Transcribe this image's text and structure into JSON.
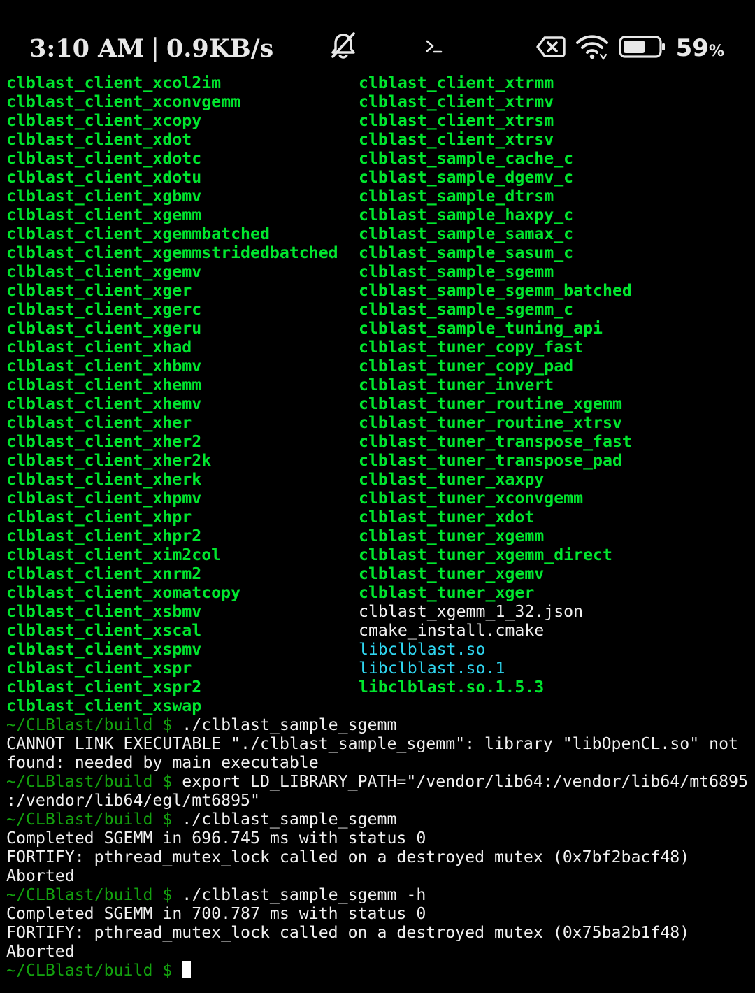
{
  "status_bar": {
    "time": "3:10 AM",
    "separator": "|",
    "net_speed": "0.9KB/s",
    "battery_percent": "59",
    "battery_percent_sign": "%",
    "battery_level": 0.59,
    "icons": [
      "bell-muted-icon",
      "terminal-prompt-icon",
      "sim-error-icon",
      "wifi-icon",
      "battery-icon"
    ]
  },
  "ls_listing": {
    "left_column": [
      "clblast_client_xcol2im",
      "clblast_client_xconvgemm",
      "clblast_client_xcopy",
      "clblast_client_xdot",
      "clblast_client_xdotc",
      "clblast_client_xdotu",
      "clblast_client_xgbmv",
      "clblast_client_xgemm",
      "clblast_client_xgemmbatched",
      "clblast_client_xgemmstridedbatched",
      "clblast_client_xgemv",
      "clblast_client_xger",
      "clblast_client_xgerc",
      "clblast_client_xgeru",
      "clblast_client_xhad",
      "clblast_client_xhbmv",
      "clblast_client_xhemm",
      "clblast_client_xhemv",
      "clblast_client_xher",
      "clblast_client_xher2",
      "clblast_client_xher2k",
      "clblast_client_xherk",
      "clblast_client_xhpmv",
      "clblast_client_xhpr",
      "clblast_client_xhpr2",
      "clblast_client_xim2col",
      "clblast_client_xnrm2",
      "clblast_client_xomatcopy",
      "clblast_client_xsbmv",
      "clblast_client_xscal",
      "clblast_client_xspmv",
      "clblast_client_xspr",
      "clblast_client_xspr2",
      "clblast_client_xswap"
    ],
    "right_column": [
      {
        "name": "clblast_client_xtrmm",
        "kind": "exec"
      },
      {
        "name": "clblast_client_xtrmv",
        "kind": "exec"
      },
      {
        "name": "clblast_client_xtrsm",
        "kind": "exec"
      },
      {
        "name": "clblast_client_xtrsv",
        "kind": "exec"
      },
      {
        "name": "clblast_sample_cache_c",
        "kind": "exec"
      },
      {
        "name": "clblast_sample_dgemv_c",
        "kind": "exec"
      },
      {
        "name": "clblast_sample_dtrsm",
        "kind": "exec"
      },
      {
        "name": "clblast_sample_haxpy_c",
        "kind": "exec"
      },
      {
        "name": "clblast_sample_samax_c",
        "kind": "exec"
      },
      {
        "name": "clblast_sample_sasum_c",
        "kind": "exec"
      },
      {
        "name": "clblast_sample_sgemm",
        "kind": "exec"
      },
      {
        "name": "clblast_sample_sgemm_batched",
        "kind": "exec"
      },
      {
        "name": "clblast_sample_sgemm_c",
        "kind": "exec"
      },
      {
        "name": "clblast_sample_tuning_api",
        "kind": "exec"
      },
      {
        "name": "clblast_tuner_copy_fast",
        "kind": "exec"
      },
      {
        "name": "clblast_tuner_copy_pad",
        "kind": "exec"
      },
      {
        "name": "clblast_tuner_invert",
        "kind": "exec"
      },
      {
        "name": "clblast_tuner_routine_xgemm",
        "kind": "exec"
      },
      {
        "name": "clblast_tuner_routine_xtrsv",
        "kind": "exec"
      },
      {
        "name": "clblast_tuner_transpose_fast",
        "kind": "exec"
      },
      {
        "name": "clblast_tuner_transpose_pad",
        "kind": "exec"
      },
      {
        "name": "clblast_tuner_xaxpy",
        "kind": "exec"
      },
      {
        "name": "clblast_tuner_xconvgemm",
        "kind": "exec"
      },
      {
        "name": "clblast_tuner_xdot",
        "kind": "exec"
      },
      {
        "name": "clblast_tuner_xgemm",
        "kind": "exec"
      },
      {
        "name": "clblast_tuner_xgemm_direct",
        "kind": "exec"
      },
      {
        "name": "clblast_tuner_xgemv",
        "kind": "exec"
      },
      {
        "name": "clblast_tuner_xger",
        "kind": "exec"
      },
      {
        "name": "clblast_xgemm_1_32.json",
        "kind": "file"
      },
      {
        "name": "cmake_install.cmake",
        "kind": "file"
      },
      {
        "name": "libclblast.so",
        "kind": "link"
      },
      {
        "name": "libclblast.so.1",
        "kind": "link"
      },
      {
        "name": "libclblast.so.1.5.3",
        "kind": "exec"
      }
    ]
  },
  "session": {
    "lines": [
      {
        "prompt": "~/CLBlast/build $ ",
        "text": "./clblast_sample_sgemm"
      },
      {
        "prompt": "",
        "text": "CANNOT LINK EXECUTABLE \"./clblast_sample_sgemm\": library \"libOpenCL.so\" not"
      },
      {
        "prompt": "",
        "text": "found: needed by main executable"
      },
      {
        "prompt": "~/CLBlast/build $ ",
        "text": "export LD_LIBRARY_PATH=\"/vendor/lib64:/vendor/lib64/mt6895"
      },
      {
        "prompt": "",
        "text": ":/vendor/lib64/egl/mt6895\""
      },
      {
        "prompt": "~/CLBlast/build $ ",
        "text": "./clblast_sample_sgemm"
      },
      {
        "prompt": "",
        "text": "Completed SGEMM in 696.745 ms with status 0"
      },
      {
        "prompt": "",
        "text": "FORTIFY: pthread_mutex_lock called on a destroyed mutex (0x7bf2bacf48)"
      },
      {
        "prompt": "",
        "text": "Aborted"
      },
      {
        "prompt": "~/CLBlast/build $ ",
        "text": "./clblast_sample_sgemm -h"
      },
      {
        "prompt": "",
        "text": "Completed SGEMM in 700.787 ms with status 0"
      },
      {
        "prompt": "",
        "text": "FORTIFY: pthread_mutex_lock called on a destroyed mutex (0x75ba2b1f48)"
      },
      {
        "prompt": "",
        "text": "Aborted"
      }
    ],
    "current_prompt": "~/CLBlast/build $ "
  },
  "colors": {
    "exec": "#00e62e",
    "link": "#2fd6f0",
    "prompt": "#13a10e",
    "text": "#f0f0f0",
    "background": "#000000"
  }
}
